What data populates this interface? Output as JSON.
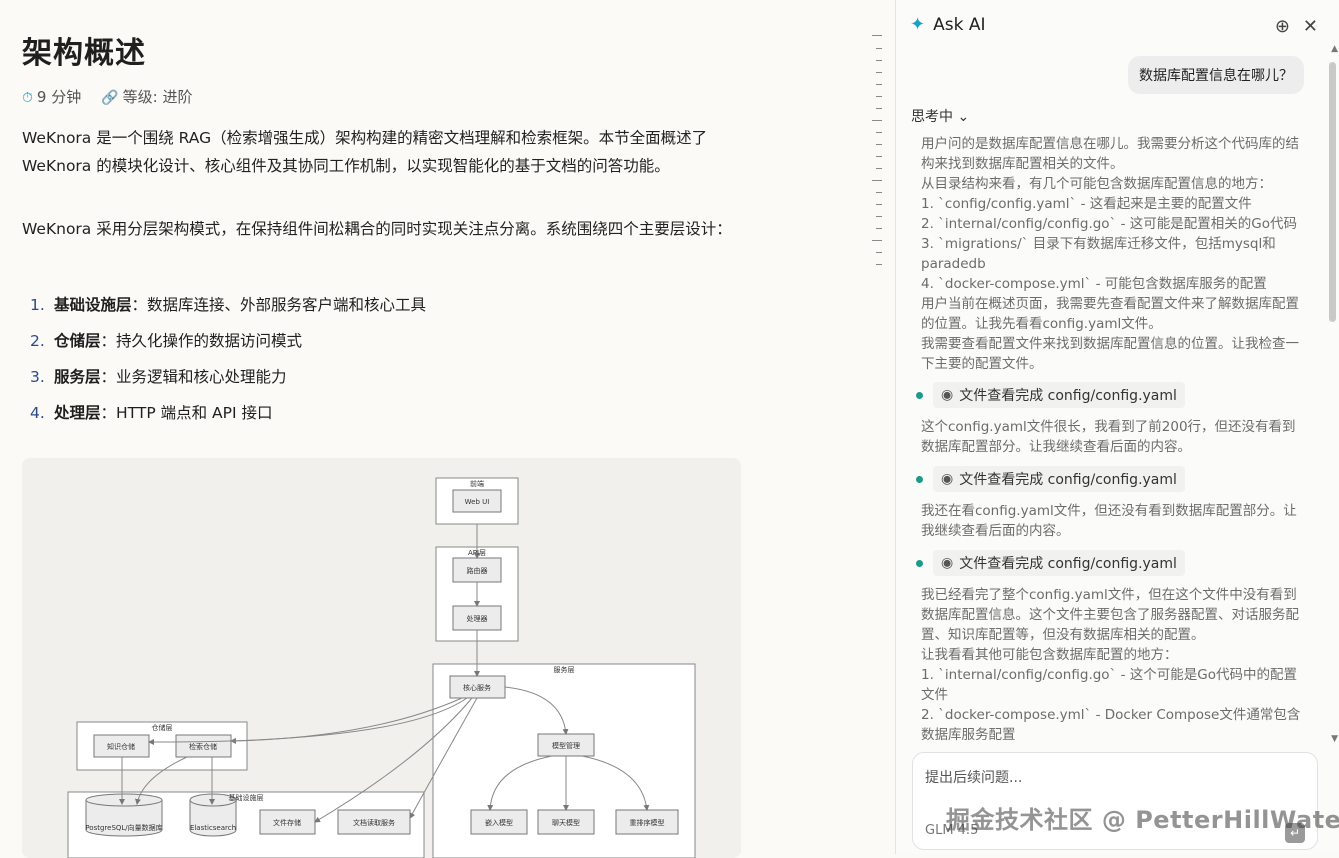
{
  "article": {
    "title": "架构概述",
    "read_time": "9 分钟",
    "level": "等级: 进阶",
    "intro": "WeKnora 是一个围绕 RAG（检索增强生成）架构构建的精密文档理解和检索框架。本节全面概述了 WeKnora 的模块化设计、核心组件及其协同工作机制，以实现智能化的基于文档的问答功能。",
    "layers_intro": "WeKnora 采用分层架构模式，在保持组件间松耦合的同时实现关注点分离。系统围绕四个主要层设计：",
    "layers": [
      {
        "num": "1.",
        "name": "基础设施层",
        "desc": "：数据库连接、外部服务客户端和核心工具"
      },
      {
        "num": "2.",
        "name": "仓储层",
        "desc": "：持久化操作的数据访问模式"
      },
      {
        "num": "3.",
        "name": "服务层",
        "desc": "：业务逻辑和核心处理能力"
      },
      {
        "num": "4.",
        "name": "处理层",
        "desc": "：HTTP 端点和 API 接口"
      }
    ],
    "diagram": {
      "frontend_group": "前端",
      "web_ui": "Web UI",
      "api_group": "API层",
      "router": "路由器",
      "handler": "处理器",
      "service_group": "服务层",
      "core_service": "核心服务",
      "model_mgmt": "模型管理",
      "embed_model": "嵌入模型",
      "chat_model": "聊天模型",
      "rerank_model": "重排序模型",
      "repo_group": "仓储层",
      "kb_repo": "知识仓储",
      "retrieve_repo": "检索仓储",
      "infra_group": "基础设施层",
      "postgres": "PostgreSQL/向量数据库",
      "elasticsearch": "Elasticsearch",
      "file_storage": "文件存储",
      "doc_reader": "文档读取服务"
    }
  },
  "panel": {
    "title": "Ask AI",
    "user_question": "数据库配置信息在哪儿？",
    "thinking_label": "思考中",
    "thought1": [
      "用户问的是数据库配置信息在哪儿。我需要分析这个代码库的结构来找到数据库配置相关的文件。",
      "从目录结构来看，有几个可能包含数据库配置信息的地方：",
      "1. `config/config.yaml` - 这看起来是主要的配置文件",
      "2. `internal/config/config.go` - 这可能是配置相关的Go代码",
      "3. `migrations/` 目录下有数据库迁移文件，包括mysql和paradedb",
      "4. `docker-compose.yml` - 可能包含数据库服务的配置",
      "用户当前在概述页面，我需要先查看配置文件来了解数据库配置的位置。让我先看看config.yaml文件。",
      "我需要查看配置文件来找到数据库配置信息的位置。让我检查一下主要的配置文件。"
    ],
    "tool_label": "文件查看完成 config/config.yaml",
    "thought2": "这个config.yaml文件很长，我看到了前200行，但还没有看到数据库配置部分。让我继续查看后面的内容。",
    "thought3": "我还在看config.yaml文件，但还没有看到数据库配置部分。让我继续查看后面的内容。",
    "thought4": [
      "我已经看完了整个config.yaml文件，但在这个文件中没有看到数据库配置信息。这个文件主要包含了服务器配置、对话服务配置、知识库配置等，但没有数据库相关的配置。",
      "让我看看其他可能包含数据库配置的地方：",
      "1. `internal/config/config.go` - 这个可能是Go代码中的配置文件",
      "2. `docker-compose.yml` - Docker Compose文件通常包含数据库服务配置"
    ],
    "input_placeholder": "提出后续问题...",
    "model": "GLM 4.5",
    "watermark": "掘金技术社区 @ PetterHillWater"
  }
}
